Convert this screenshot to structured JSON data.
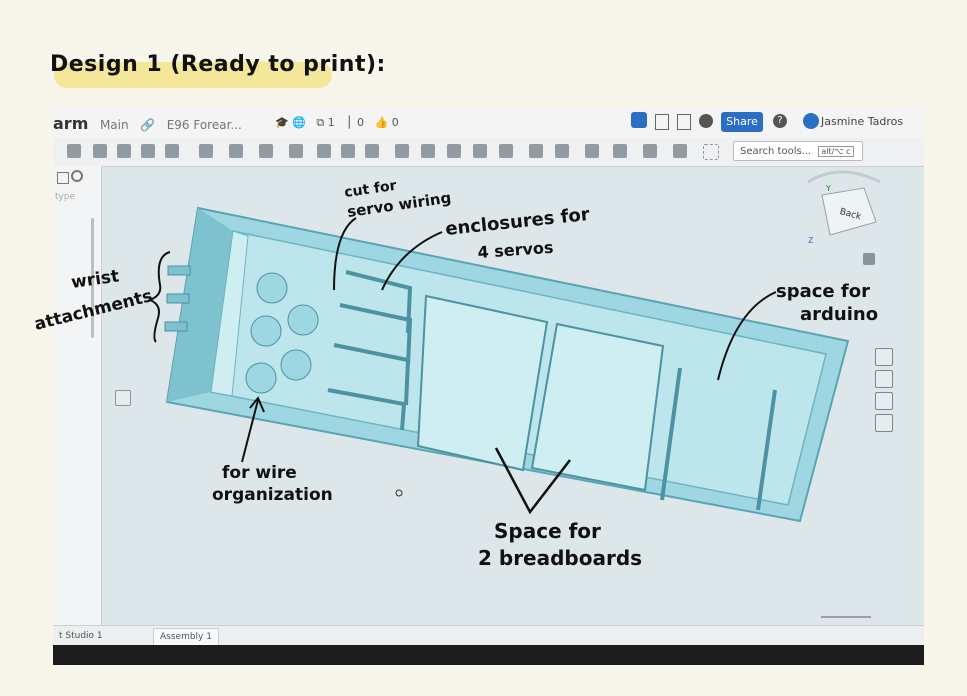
{
  "page": {
    "title": "Design 1 (Ready to print):"
  },
  "app": {
    "doc_name": "arm",
    "branch": "Main",
    "breadcrumb": "E96 Forear...",
    "version_count": "1",
    "branch_count": "0",
    "like_count": "0",
    "share_label": "Share",
    "user_name": "Jasmine Tadros",
    "search_placeholder": "Search tools...",
    "search_shortcut": "alt/⌥ c",
    "filter_placeholder": "type",
    "tabs": [
      "t Studio 1",
      "Assembly 1"
    ]
  },
  "viewcube": {
    "label": "Back",
    "axes": [
      "Y",
      "Z"
    ]
  },
  "annotations": {
    "servo_cut_line1": "cut for",
    "servo_cut_line2": "servo wiring",
    "enclosures_line1": "enclosures for",
    "enclosures_line2": "4 servos",
    "wrist_line1": "wrist",
    "wrist_line2": "attachments",
    "arduino_line1": "space for",
    "arduino_line2": "arduino",
    "wire_line1": "for wire",
    "wire_line2": "organization",
    "breadboards_line1": "Space for",
    "breadboards_line2": "2 breadboards"
  },
  "colors": {
    "background": "#f8f5eb",
    "highlight": "#f5e79a",
    "model": "#a9dfe8",
    "model_dark": "#5aa3b3",
    "share": "#2b6fc4"
  }
}
